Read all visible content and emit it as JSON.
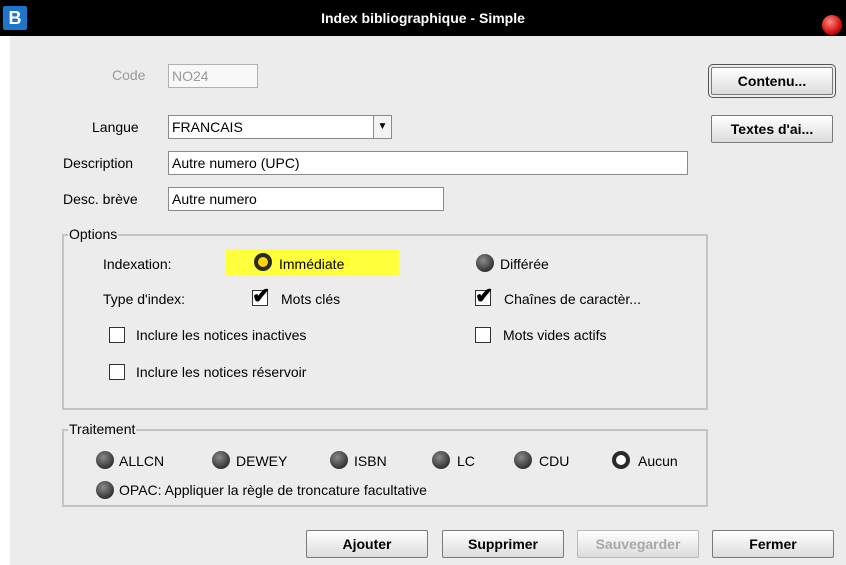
{
  "window": {
    "title": "Index bibliographique - Simple",
    "app_icon": "B"
  },
  "form": {
    "code_label": "Code",
    "code_value": "NO24",
    "langue_label": "Langue",
    "langue_value": "FRANCAIS",
    "description_label": "Description",
    "description_value": "Autre numero (UPC)",
    "desc_breve_label": "Desc. brève",
    "desc_breve_value": "Autre numero"
  },
  "side_buttons": {
    "contenu": "Contenu...",
    "textes": "Textes d'ai..."
  },
  "options": {
    "legend": "Options",
    "indexation_label": "Indexation:",
    "immediate": "Immédiate",
    "differee": "Différée",
    "type_label": "Type d'index:",
    "mots_cles": "Mots clés",
    "chaines": "Chaînes de caractèr...",
    "inclure_inactives": "Inclure les notices inactives",
    "mots_vides": "Mots vides actifs",
    "inclure_reservoir": "Inclure les notices réservoir"
  },
  "traitement": {
    "legend": "Traitement",
    "items": [
      "ALLCN",
      "DEWEY",
      "ISBN",
      "LC",
      "CDU",
      "Aucun"
    ],
    "selected": "Aucun",
    "opac": "OPAC: Appliquer la règle de troncature facultative"
  },
  "buttons": {
    "ajouter": "Ajouter",
    "supprimer": "Supprimer",
    "sauvegarder": "Sauvegarder",
    "fermer": "Fermer"
  },
  "colors": {
    "titlebar": "#000000",
    "highlight": "#ffff3c",
    "background": "#ececec"
  }
}
